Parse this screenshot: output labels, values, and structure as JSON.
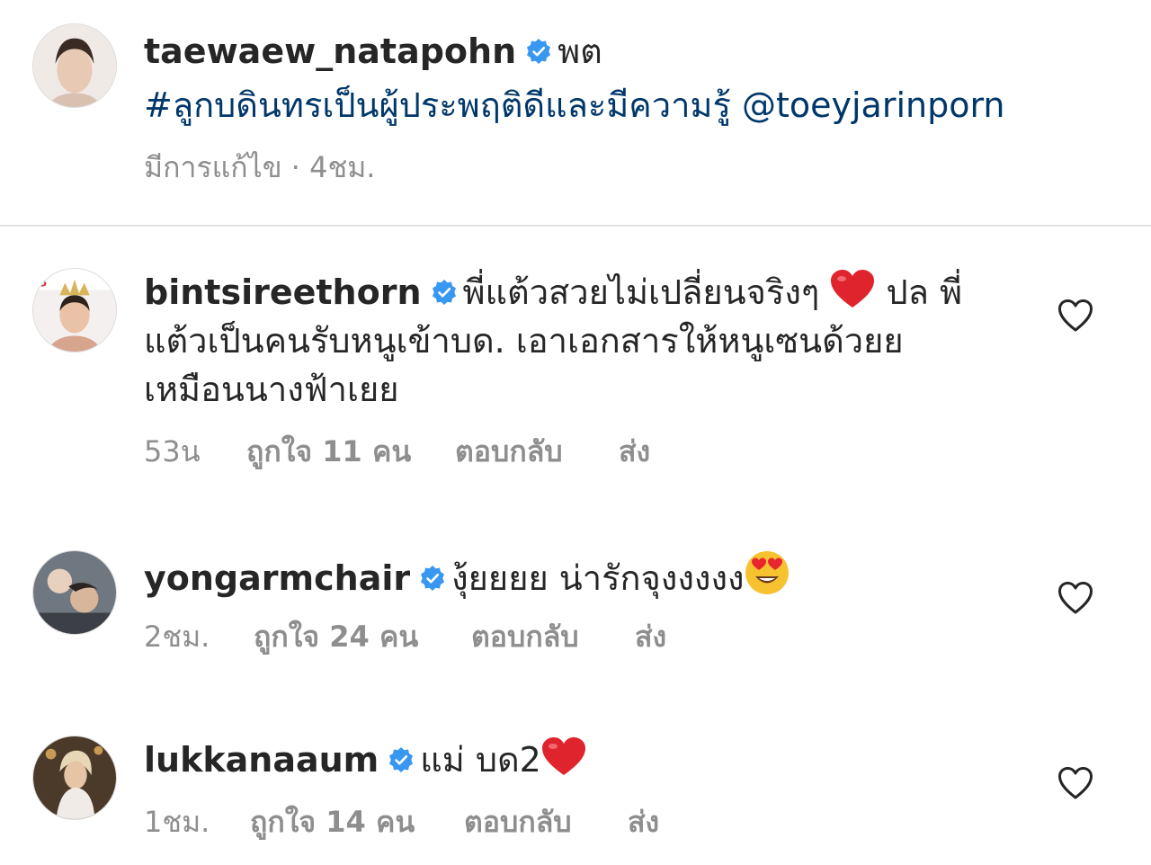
{
  "caption": {
    "username": "taewaew_natapohn",
    "text_suffix": "พต",
    "line2_hashtag": "#ลูกบดินทรเป็นผู้ประพฤติดีและมีความรู้",
    "line2_mention": "@toeyjarinporn",
    "edited": "มีการแก้ไข · 4ชม."
  },
  "comments": [
    {
      "username": "bintsireethorn",
      "text_a": "พี่แต้วสวยไม่เปลี่ยนจริงๆ",
      "text_b": "ปล พี่",
      "line2": "แต้วเป็นคนรับหนูเข้าบด. เอาเอกสารให้หนูเซนด้วยย",
      "line3": "เหมือนนางฟ้าเยย",
      "time": "53น",
      "likes": "ถูกใจ 11 คน",
      "reply": "ตอบกลับ",
      "send": "ส่ง"
    },
    {
      "username": "yongarmchair",
      "text": "งุ้ยยยย น่ารักจุงงงงง",
      "time": "2ชม.",
      "likes": "ถูกใจ 24 คน",
      "reply": "ตอบกลับ",
      "send": "ส่ง"
    },
    {
      "username": "lukkanaaum",
      "text": "แม่ บด2",
      "time": "1ชม.",
      "likes": "ถูกใจ 14 คน",
      "reply": "ตอบกลับ",
      "send": "ส่ง"
    }
  ],
  "icons": {
    "verified": "verified-badge-icon",
    "heart": "heart-outline-icon",
    "emoji_heart": "red-heart-emoji",
    "emoji_love": "heart-eyes-emoji"
  },
  "colors": {
    "text": "#262626",
    "secondary": "#8e8e8e",
    "link": "#00376b",
    "verified": "#3897f0"
  }
}
